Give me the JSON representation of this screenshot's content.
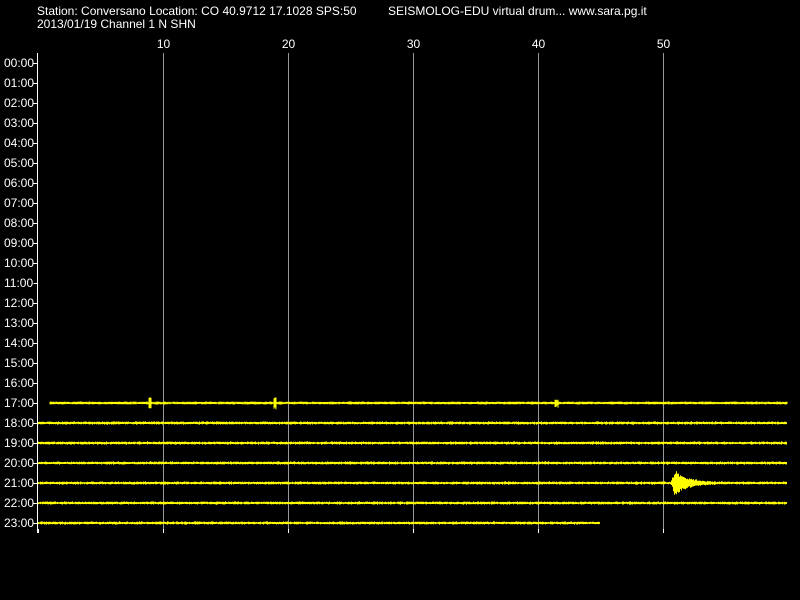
{
  "header": {
    "station_line": "Station: Conversano Location: CO 40.9712 17.1028 SPS:50",
    "program_line": "SEISMOLOG-EDU virtual drum... www.sara.pg.it",
    "date_line": "2013/01/19  Channel 1 N SHN"
  },
  "colors": {
    "background": "#000000",
    "text": "#ffffff",
    "trace": "#ffff00",
    "grid": "#ffffff"
  },
  "chart_data": {
    "type": "line",
    "title": "",
    "xlabel": "",
    "ylabel": "",
    "x_unit_axis_range_minutes": [
      0,
      60
    ],
    "x_ticks": [
      10,
      20,
      30,
      40,
      50
    ],
    "x_tick_labels": [
      "10",
      "20",
      "30",
      "40",
      "50"
    ],
    "grid": "vertical lines at each x tick",
    "legend": "none",
    "row_labels": [
      "00:00",
      "01:00",
      "02:00",
      "03:00",
      "04:00",
      "05:00",
      "06:00",
      "07:00",
      "08:00",
      "09:00",
      "10:00",
      "11:00",
      "12:00",
      "13:00",
      "14:00",
      "15:00",
      "16:00",
      "17:00",
      "18:00",
      "19:00",
      "20:00",
      "21:00",
      "22:00",
      "23:00"
    ],
    "traces": [
      {
        "hour": "17:00",
        "start_minute": 1,
        "end_minute": 60,
        "events": [
          {
            "minute": 9,
            "amplitude": 0.5
          },
          {
            "minute": 19,
            "amplitude": 0.5
          },
          {
            "minute": 41.5,
            "amplitude": 0.3
          }
        ]
      },
      {
        "hour": "18:00",
        "start_minute": 0,
        "end_minute": 60,
        "events": []
      },
      {
        "hour": "19:00",
        "start_minute": 0,
        "end_minute": 60,
        "events": []
      },
      {
        "hour": "20:00",
        "start_minute": 0,
        "end_minute": 60,
        "events": []
      },
      {
        "hour": "21:00",
        "start_minute": 0,
        "end_minute": 60,
        "events": [
          {
            "minute": 51,
            "amplitude": 1.0
          }
        ]
      },
      {
        "hour": "22:00",
        "start_minute": 0,
        "end_minute": 60,
        "events": []
      },
      {
        "hour": "23:00",
        "start_minute": 0,
        "end_minute": 45,
        "events": []
      }
    ]
  }
}
